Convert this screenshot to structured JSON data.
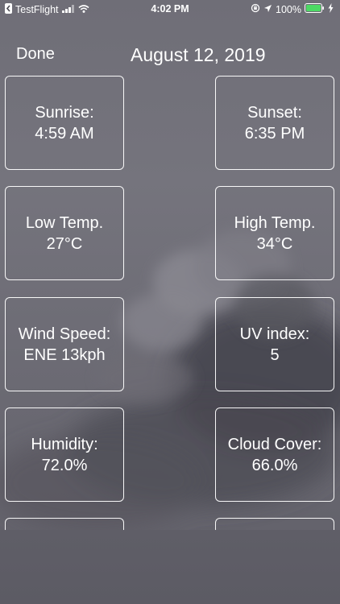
{
  "status_bar": {
    "back_app": "TestFlight",
    "time": "4:02 PM",
    "battery_percent": "100%"
  },
  "header": {
    "done_label": "Done",
    "date": "August 12, 2019"
  },
  "tiles": [
    {
      "label": "Sunrise:",
      "value": "4:59 AM"
    },
    {
      "label": "Sunset:",
      "value": "6:35 PM"
    },
    {
      "label": "Low Temp.",
      "value": "27°C"
    },
    {
      "label": "High Temp.",
      "value": "34°C"
    },
    {
      "label": "Wind Speed:",
      "value": "ENE 13kph"
    },
    {
      "label": "UV index:",
      "value": "5"
    },
    {
      "label": "Humidity:",
      "value": "72.0%"
    },
    {
      "label": "Cloud Cover:",
      "value": "66.0%"
    }
  ],
  "icons": {
    "back": "chevron-left-icon",
    "signal": "cellular-signal-icon",
    "wifi": "wifi-icon",
    "orientation_lock": "orientation-lock-icon",
    "location": "location-arrow-icon",
    "battery": "battery-icon",
    "charging": "charging-bolt-icon"
  },
  "colors": {
    "background": "#6f6e77",
    "text": "#ffffff",
    "battery_fill": "#4cd964"
  }
}
